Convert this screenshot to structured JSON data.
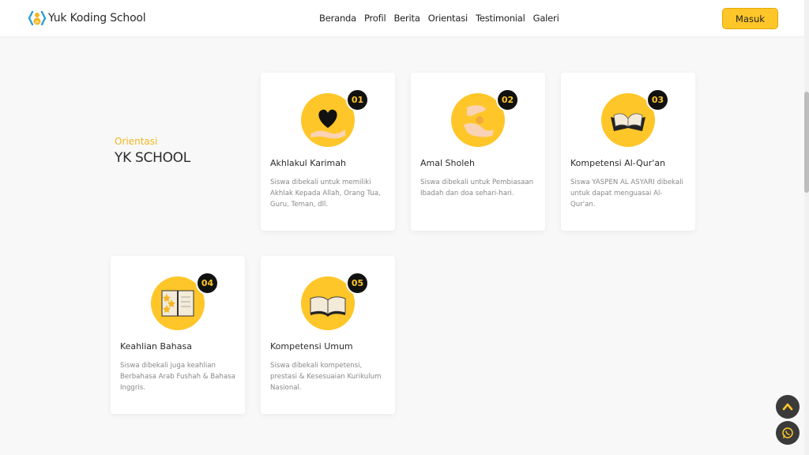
{
  "brand": {
    "name": "Yuk Koding School",
    "logo_icon": "yk-logo-icon"
  },
  "nav": {
    "links": [
      "Beranda",
      "Profil",
      "Berita",
      "Orientasi",
      "Testimonial",
      "Galeri"
    ],
    "login_label": "Masuk"
  },
  "section": {
    "kicker": "Orientasi",
    "title": "YK SCHOOL"
  },
  "cards": [
    {
      "number": "01",
      "title": "Akhlakul Karimah",
      "description": "Siswa dibekali untuk memiliki Akhlak Kepada Allah, Orang Tua, Guru, Teman, dll.",
      "icon": "heart-hand-icon"
    },
    {
      "number": "02",
      "title": "Amal Sholeh",
      "description": "Siswa dibekali untuk Pembiasaan Ibadah dan doa sehari-hari.",
      "icon": "giving-hands-icon"
    },
    {
      "number": "03",
      "title": "Kompetensi Al-Qur'an",
      "description": "Siswa YASPEN AL ASYARI dibekali untuk dapat menguasai Al-Qur'an.",
      "icon": "quran-stand-icon"
    },
    {
      "number": "04",
      "title": "Keahlian Bahasa",
      "description": "Siswa dibekali juga keahlian Berbahasa Arab Fushah & Bahasa Inggris.",
      "icon": "star-book-icon"
    },
    {
      "number": "05",
      "title": "Kompetensi Umum",
      "description": "Siswa dibekali kompetensi, prestasi & Kesesuaian Kurikulum Nasional.",
      "icon": "open-book-icon"
    }
  ],
  "floating": {
    "scroll_top_icon": "chevron-up-icon",
    "whatsapp_icon": "whatsapp-icon"
  },
  "colors": {
    "accent": "#ffc629",
    "dark": "#111111",
    "background": "#f8f8f8"
  }
}
